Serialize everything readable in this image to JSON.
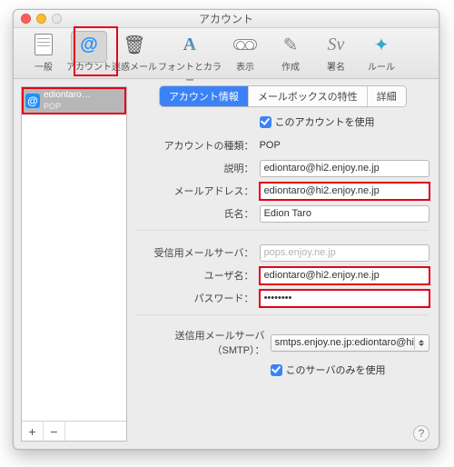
{
  "window": {
    "title": "アカウント"
  },
  "toolbar": {
    "items": [
      {
        "label": "一般"
      },
      {
        "label": "アカウント"
      },
      {
        "label": "迷惑メール"
      },
      {
        "label": "フォントとカラー"
      },
      {
        "label": "表示"
      },
      {
        "label": "作成"
      },
      {
        "label": "署名"
      },
      {
        "label": "ルール"
      }
    ],
    "selected_index": 1
  },
  "sidebar": {
    "accounts": [
      {
        "name": "ediontaro…",
        "kind": "POP"
      }
    ],
    "add_glyph": "+",
    "remove_glyph": "−"
  },
  "tabs": {
    "items": [
      "アカウント情報",
      "メールボックスの特性",
      "詳細"
    ],
    "active_index": 0
  },
  "form": {
    "enable_account": {
      "label": "このアカウントを使用",
      "checked": true
    },
    "account_type": {
      "label": "アカウントの種類：",
      "value": "POP"
    },
    "description": {
      "label": "説明：",
      "value": "ediontaro@hi2.enjoy.ne.jp"
    },
    "email": {
      "label": "メールアドレス：",
      "value": "ediontaro@hi2.enjoy.ne.jp"
    },
    "full_name": {
      "label": "氏名：",
      "value": "Edion Taro"
    },
    "incoming": {
      "label": "受信用メールサーバ：",
      "value": "pops.enjoy.ne.jp"
    },
    "username": {
      "label": "ユーザ名：",
      "value": "ediontaro@hi2.enjoy.ne.jp"
    },
    "password": {
      "label": "パスワード：",
      "value": "••••••••"
    },
    "smtp": {
      "label": "送信用メールサーバ（SMTP）：",
      "value": "smtps.enjoy.ne.jp:ediontaro@hi"
    },
    "smtp_only": {
      "label": "このサーバのみを使用",
      "checked": true
    }
  },
  "help_glyph": "?"
}
